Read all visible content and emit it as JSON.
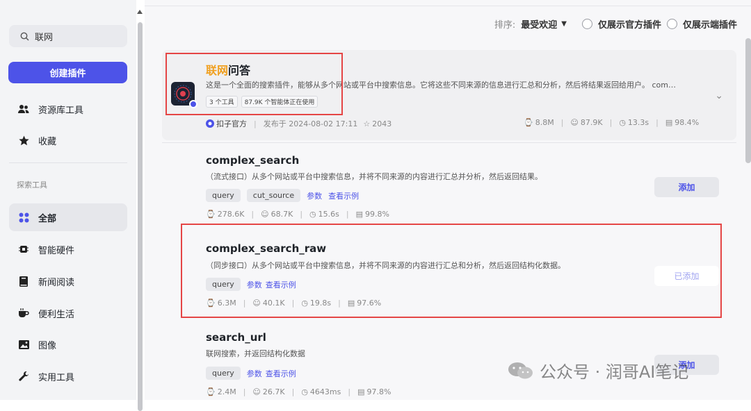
{
  "sidebar": {
    "search_value": "联网",
    "create_button": "创建插件",
    "items_top": [
      {
        "label": "资源库工具",
        "icon": "users-icon"
      },
      {
        "label": "收藏",
        "icon": "star-icon"
      }
    ],
    "section_label": "探索工具",
    "items": [
      {
        "label": "全部",
        "icon": "grid-icon",
        "active": true
      },
      {
        "label": "智能硬件",
        "icon": "chip-icon"
      },
      {
        "label": "新闻阅读",
        "icon": "book-icon"
      },
      {
        "label": "便利生活",
        "icon": "coffee-icon"
      },
      {
        "label": "图像",
        "icon": "image-icon"
      },
      {
        "label": "实用工具",
        "icon": "wrench-icon"
      }
    ]
  },
  "filters": {
    "sort_label": "排序:",
    "sort_value": "最受欢迎",
    "official_only": "仅展示官方插件",
    "client_only": "仅展示端插件"
  },
  "plugin": {
    "title_highlight": "联网",
    "title_rest": "问答",
    "description": "这是一个全面的搜索插件，能够从多个网站或平台中搜索信息。它将这些不同来源的信息进行汇总和分析，然后将结果返回给用户。 com…",
    "tag_tools": "3 个工具",
    "tag_agents": "87.9K 个智能体正在使用",
    "author": "扣子官方",
    "published": "发布于 2024-08-02 17:11",
    "stars": "2043",
    "stats": {
      "calls": "8.8M",
      "bots": "87.9K",
      "time": "13.3s",
      "success": "98.4%"
    }
  },
  "tools": [
    {
      "name": "complex_search",
      "description": "（流式接口）从多个网站或平台中搜索信息，并将不同来源的内容进行汇总并分析，然后返回结果。",
      "params": [
        "query",
        "cut_source"
      ],
      "link_params": "参数",
      "link_example": "查看示例",
      "button": "添加",
      "added": false,
      "stats": {
        "calls": "278.6K",
        "bots": "68.7K",
        "time": "15.6s",
        "success": "99.8%"
      }
    },
    {
      "name": "complex_search_raw",
      "description": "（同步接口）从多个网站或平台中搜索信息，并将不同来源的内容进行汇总和分析，然后返回结构化数据。",
      "params": [
        "query"
      ],
      "link_params": "参数",
      "link_example": "查看示例",
      "button": "已添加",
      "added": true,
      "stats": {
        "calls": "6.3M",
        "bots": "40.1K",
        "time": "19.8s",
        "success": "97.6%"
      }
    },
    {
      "name": "search_url",
      "description": "联网搜索，并返回结构化数据",
      "params": [
        "query"
      ],
      "link_params": "参数",
      "link_example": "查看示例",
      "button": "添加",
      "added": false,
      "stats": {
        "calls": "2.4M",
        "bots": "26.7K",
        "time": "4643ms",
        "success": "97.8%"
      }
    }
  ],
  "watermark": "公众号 · 润哥AI笔记",
  "colors": {
    "accent": "#4d53e8",
    "highlight": "#f0a020",
    "annotation_box": "#e54545"
  }
}
